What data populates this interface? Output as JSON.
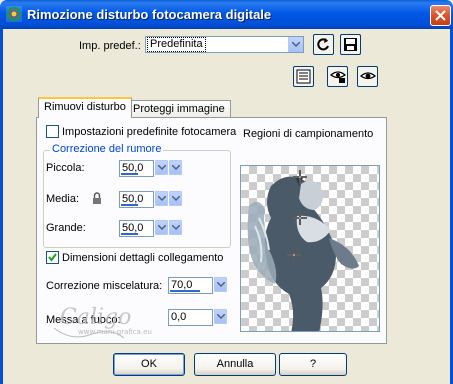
{
  "window": {
    "title": "Rimozione disturbo fotocamera digitale"
  },
  "preset": {
    "label": "Imp. predef.:",
    "value": "Predefinita"
  },
  "tabs": [
    {
      "label": "Rimuovi disturbo",
      "active": true
    },
    {
      "label": "Proteggi immagine",
      "active": false
    }
  ],
  "camera_defaults": {
    "label": "Impostazioni predefinite fotocamera",
    "checked": false
  },
  "noise_correction": {
    "title": "Correzione del rumore",
    "small": {
      "label": "Piccola:",
      "value": "50,0"
    },
    "medium": {
      "label": "Media:",
      "value": "50,0"
    },
    "large": {
      "label": "Grande:",
      "value": "50,0"
    }
  },
  "link_details": {
    "label": "Dimensioni dettagli collegamento",
    "checked": true
  },
  "blend_correction": {
    "label": "Correzione miscelatura:",
    "value": "70,0"
  },
  "sharpen": {
    "label": "Messa a fuoco:",
    "value": "0,0"
  },
  "sampling": {
    "label": "Regioni di campionamento"
  },
  "watermark": {
    "name": "Caligo",
    "site": "www.mani-grafica.eu"
  },
  "buttons": {
    "ok": "OK",
    "cancel": "Annulla",
    "help": "?"
  },
  "colors": {
    "accent": "#0046D5",
    "titlebar": "#0058E6",
    "dialog_bg": "#ECE9D8"
  }
}
